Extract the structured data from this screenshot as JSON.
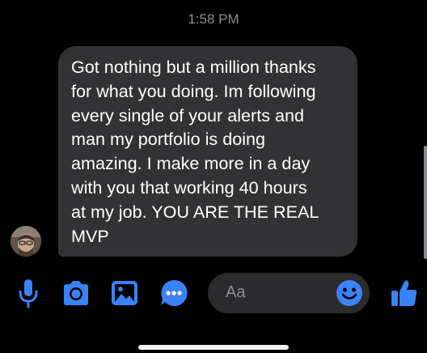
{
  "timestamp": "1:58 PM",
  "message": {
    "lines": [
      "Got nothing but a million thanks",
      "for what you doing. Im following",
      "every single of your alerts and",
      "man my portfolio is doing",
      "amazing. I make more in a day",
      "with you that working 40 hours",
      "at my job. YOU ARE THE REAL",
      "MVP"
    ]
  },
  "composer": {
    "placeholder": "Aa"
  },
  "toolbar": {
    "icons": [
      "microphone-icon",
      "camera-icon",
      "image-icon",
      "more-icon",
      "emoji-icon",
      "thumbs-up-icon"
    ]
  },
  "colors": {
    "background": "#000000",
    "bubble": "#323234",
    "accent": "#3a82f7",
    "timestamp": "#8e8e93",
    "composer": "#2b2b2d"
  }
}
